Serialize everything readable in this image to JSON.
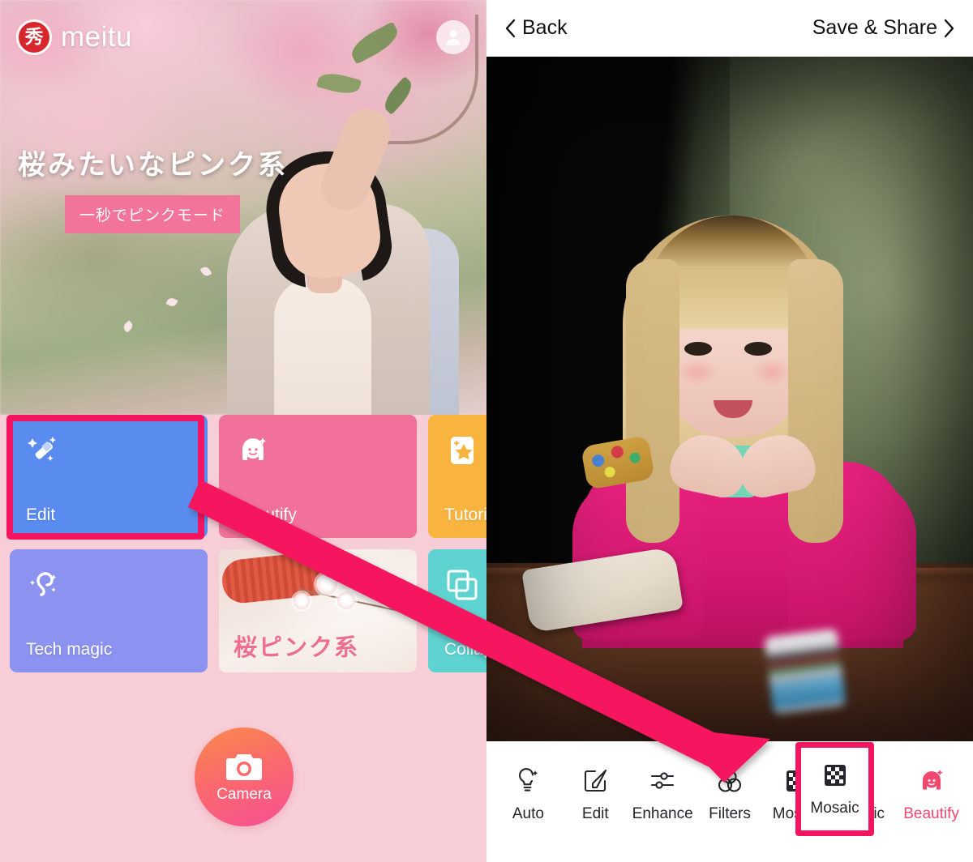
{
  "left_app": {
    "brand": {
      "mark_text": "秀",
      "wordmark": "meitu"
    },
    "avatar_name": "account-avatar",
    "hero": {
      "headline": "桜みたいなピンク系",
      "cta_label": "一秒でピンクモード"
    },
    "tiles": [
      {
        "id": "edit",
        "label": "Edit",
        "color": "#5a8cf0",
        "icon": "magic-wand-icon",
        "highlighted": true
      },
      {
        "id": "beautify",
        "label": "Beautify",
        "color": "#f2719b",
        "icon": "girl-face-icon",
        "highlighted": false
      },
      {
        "id": "tutorial",
        "label": "Tutorial",
        "color": "#f9b43f",
        "icon": "photo-star-icon",
        "highlighted": false
      },
      {
        "id": "tech-magic",
        "label": "Tech magic",
        "color": "#8b92ef",
        "icon": "hair-swirl-icon",
        "highlighted": false
      },
      {
        "id": "sakura",
        "label": "桜ピンク系",
        "color": "#f3e6df",
        "icon": "",
        "highlighted": false
      },
      {
        "id": "collage",
        "label": "Collage",
        "color": "#5fd3d1",
        "icon": "frames-icon",
        "highlighted": false
      }
    ],
    "camera": {
      "label": "Camera",
      "icon": "camera-icon"
    }
  },
  "editor": {
    "header": {
      "back_label": "Back",
      "back_icon": "chevron-left-icon",
      "save_label": "Save & Share",
      "save_icon": "chevron-right-icon"
    },
    "toolbar": [
      {
        "id": "auto",
        "label": "Auto",
        "icon": "auto-bulb-icon",
        "selected": false
      },
      {
        "id": "edit",
        "label": "Edit",
        "icon": "pencil-square-icon",
        "selected": false
      },
      {
        "id": "enhance",
        "label": "Enhance",
        "icon": "sliders-icon",
        "selected": false
      },
      {
        "id": "filters",
        "label": "Filters",
        "icon": "three-circles-icon",
        "selected": false
      },
      {
        "id": "mosaic",
        "label": "Mosaic",
        "icon": "checkerboard-icon",
        "selected": true
      },
      {
        "id": "magic",
        "label": "Magic",
        "icon": "lightning-icon",
        "selected": false
      },
      {
        "id": "beautify",
        "label": "Beautify",
        "icon": "girl-face-icon",
        "selected": false
      }
    ]
  },
  "annotation": {
    "highlight_color": "#f5145f",
    "arrow_name": "instruction-arrow",
    "edit_highlight_name": "edit-tile-highlight",
    "mosaic_highlight_name": "mosaic-tool-highlight"
  }
}
